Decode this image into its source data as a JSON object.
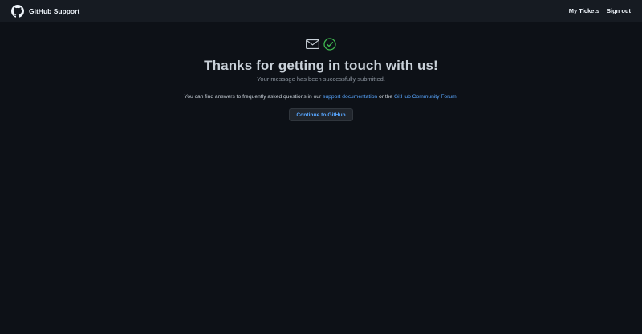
{
  "header": {
    "brand": "GitHub Support",
    "nav": {
      "my_tickets": "My Tickets",
      "sign_out": "Sign out"
    }
  },
  "main": {
    "icons": [
      "mail-icon",
      "check-circle-icon"
    ],
    "title": "Thanks for getting in touch with us!",
    "subtitle": "Your message has been successfully submitted.",
    "info": {
      "prefix": "You can find answers to frequently asked questions in our ",
      "docs_link": "support documentation",
      "middle": " or the ",
      "forum_link": "GitHub Community Forum",
      "suffix": "."
    },
    "continue_button": "Continue to GitHub"
  },
  "colors": {
    "background": "#0d1117",
    "header": "#161b22",
    "link": "#58a6ff",
    "success": "#3fb950"
  }
}
